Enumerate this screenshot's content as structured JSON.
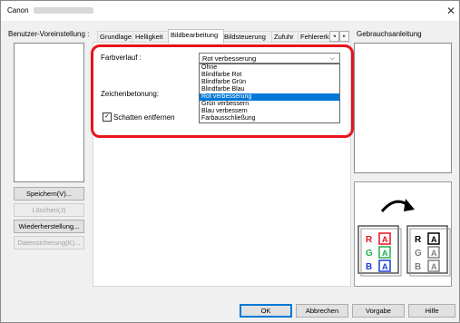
{
  "window": {
    "title": "Canon",
    "close_glyph": "✕"
  },
  "user_settings": {
    "label": "Benutzer-Voreinstellung :",
    "buttons": {
      "save": "Speichern(V)...",
      "delete": "Löschen(J)",
      "restore": "Wiederherstellung...",
      "backup": "Datensicherung(K)..."
    }
  },
  "tabs": [
    {
      "label": "Grundlage"
    },
    {
      "label": "Helligkeit"
    },
    {
      "label": "Bildbearbeitung"
    },
    {
      "label": "Bildsteuerung"
    },
    {
      "label": "Zufuhr"
    },
    {
      "label": "Fehlererk"
    }
  ],
  "tab_scroll": {
    "left": "◂",
    "right": "▸"
  },
  "image_processing": {
    "color_drop_label": "Farbverlauf :",
    "color_drop_value": "Rot verbesserung",
    "dropdown_arrow": "⌵",
    "dropdown_options": [
      "Ohne",
      "Blindfarbe Rot",
      "Blindfarbe Grün",
      "Blindfarbe Blau",
      "Rot verbesserung",
      "Grün verbessern",
      "Blau verbessern",
      "Farbausschließung"
    ],
    "selected_index": 4,
    "edge_emphasis_label": "Zeichenbetonung:",
    "shadow_remove_label": "Schatten entfernen",
    "shadow_remove_checked": true
  },
  "help_panel": {
    "label": "Gebrauchsanleitung",
    "illustration": {
      "before": [
        "R",
        "G",
        "B"
      ],
      "after": [
        "R",
        "G",
        "B"
      ],
      "colors": {
        "red": "#e8141c",
        "green": "#22b14c",
        "blue": "#1a3fd6",
        "gray": "#808080",
        "black": "#000000"
      }
    }
  },
  "footer": {
    "ok": "OK",
    "cancel": "Abbrechen",
    "default": "Vorgabe",
    "help": "Hilfe"
  }
}
